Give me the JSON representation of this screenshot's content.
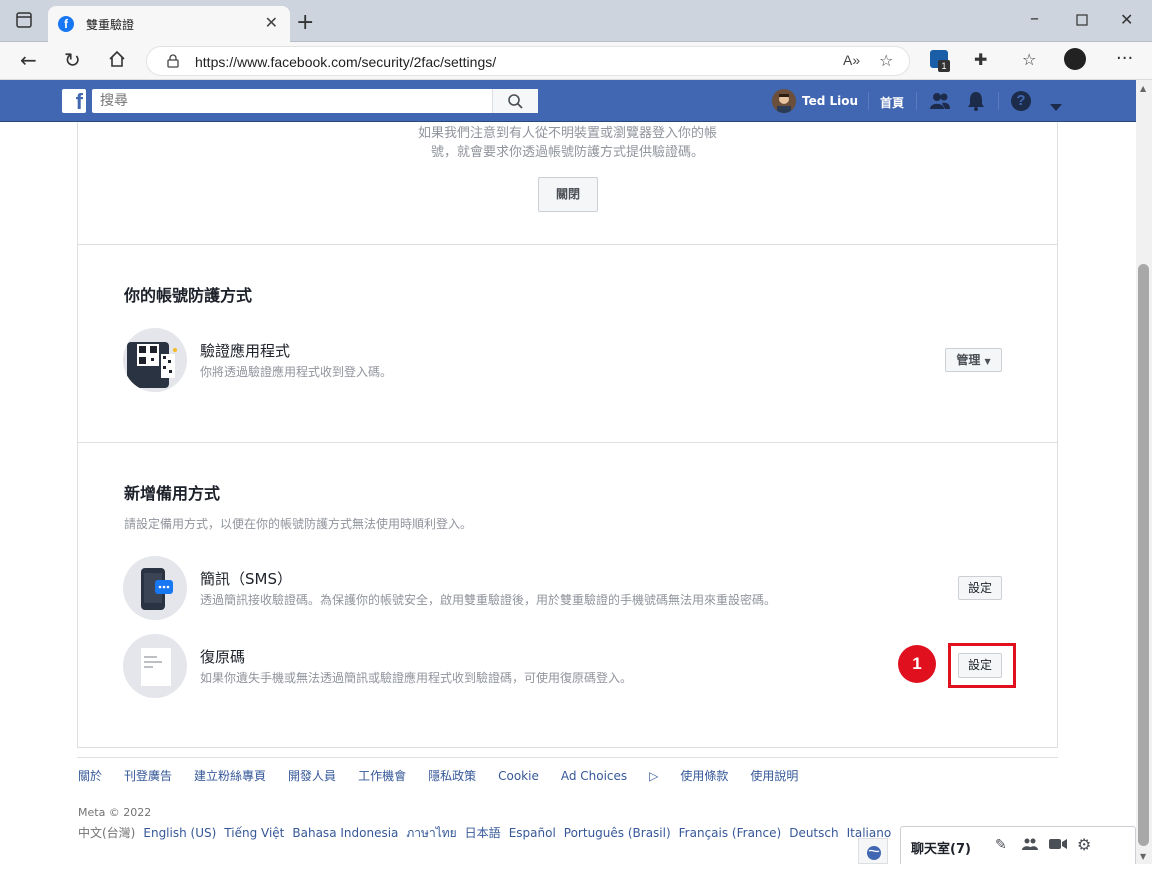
{
  "browser": {
    "tab_title": "雙重驗證",
    "tab_favicon_letter": "f",
    "url": "https://www.facebook.com/security/2fac/settings/",
    "extension_badge": "1"
  },
  "fb_header": {
    "logo_letter": "f",
    "search_placeholder": "搜尋",
    "user_name": "Ted Liou",
    "home_label": "首頁"
  },
  "intro": {
    "line1": "如果我們注意到有人從不明裝置或瀏覽器登入你的帳",
    "line2": "號，就會要求你透過帳號防護方式提供驗證碼。",
    "off_button": "關閉"
  },
  "protection": {
    "heading": "你的帳號防護方式",
    "method_title": "驗證應用程式",
    "method_desc": "你將透過驗證應用程式收到登入碼。",
    "manage_button": "管理"
  },
  "backup": {
    "heading": "新增備用方式",
    "subtext": "請設定備用方式，以便在你的帳號防護方式無法使用時順利登入。",
    "sms_title": "簡訊（SMS）",
    "sms_desc": "透過簡訊接收驗證碼。為保護你的帳號安全，啟用雙重驗證後，用於雙重驗證的手機號碼無法用來重設密碼。",
    "sms_button": "設定",
    "recovery_title": "復原碼",
    "recovery_desc": "如果你遺失手機或無法透過簡訊或驗證應用程式收到驗證碼，可使用復原碼登入。",
    "recovery_button": "設定",
    "step_badge": "1"
  },
  "footer": {
    "links": [
      "關於",
      "刊登廣告",
      "建立粉絲專頁",
      "開發人員",
      "工作機會",
      "隱私政策",
      "Cookie",
      "Ad Choices",
      "使用條款",
      "使用說明"
    ],
    "copyright": "Meta © 2022",
    "current_language": "中文(台灣)",
    "languages": [
      "English (US)",
      "Tiếng Việt",
      "Bahasa Indonesia",
      "ภาษาไทย",
      "日本語",
      "Español",
      "Português (Brasil)",
      "Français (France)",
      "Deutsch",
      "Italiano"
    ]
  },
  "chat": {
    "label": "聊天室(7)"
  },
  "colors": {
    "fb_blue": "#4267b2",
    "highlight_red": "#e0101f",
    "link_blue": "#365899"
  }
}
